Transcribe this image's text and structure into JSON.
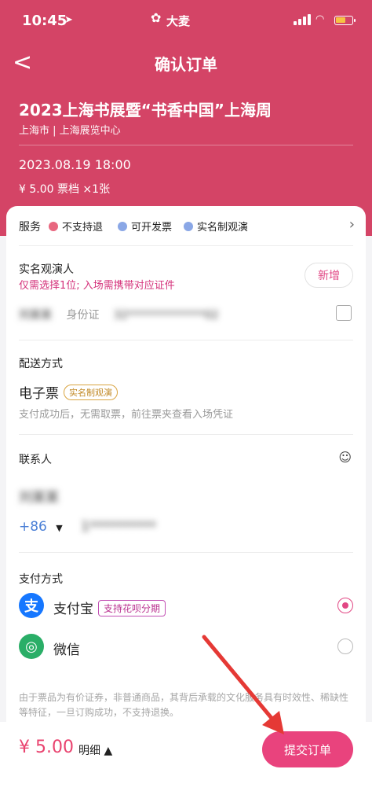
{
  "status_bar": {
    "time": "10:45",
    "carrier": "大麦"
  },
  "nav": {
    "back_symbol": "<",
    "title": "确认订单"
  },
  "event": {
    "title": "2023上海书展暨“书香中国”上海周",
    "venue": "上海市 | 上海展览中心",
    "datetime": "2023.08.19 18:00",
    "ticket": "¥ 5.00 票档  ×1张"
  },
  "services": {
    "label": "服务",
    "items": [
      {
        "text": "不支持退",
        "icon": "cross-icon",
        "color": "#e8677f"
      },
      {
        "text": "可开发票",
        "icon": "check-icon",
        "color": "#8aa7e6"
      },
      {
        "text": "实名制观演",
        "icon": "check-icon",
        "color": "#8aa7e6"
      }
    ]
  },
  "attendee": {
    "label": "实名观演人",
    "hint": "仅需选择1位; 入场需携带对应证件",
    "add_label": "新增",
    "name": "刘某某",
    "id_type": "身份证",
    "id_number": "32**************02"
  },
  "delivery": {
    "label": "配送方式",
    "method": "电子票",
    "tag": "实名制观演",
    "desc": "支付成功后，无需取票，前往票夹查看入场凭证"
  },
  "contact": {
    "label": "联系人",
    "name": "刘某某",
    "country_code": "+86",
    "phone": "1**********"
  },
  "payment": {
    "label": "支付方式",
    "options": [
      {
        "name": "支付宝",
        "tag": "支持花呗分期",
        "color": "#1677ff",
        "icon_char": "支",
        "selected": true
      },
      {
        "name": "微信",
        "color": "#2aae67",
        "icon_char": "◎",
        "selected": false
      }
    ]
  },
  "notice": "由于票品为有价证券，非普通商品，其背后承载的文化服务具有时效性、稀缺性等特征，一旦订购成功，不支持退换。",
  "footer": {
    "price": "¥ 5.00",
    "detail": "明细 ▲",
    "submit": "提交订单"
  }
}
